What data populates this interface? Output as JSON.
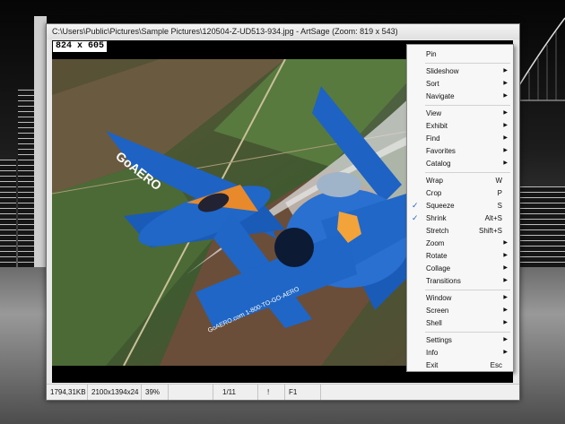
{
  "window": {
    "title": "C:\\Users\\Public\\Pictures\\Sample Pictures\\120504-Z-UD513-934.jpg - ArtSage (Zoom: 819 x 543)"
  },
  "viewer": {
    "dimensions": "824 x 605"
  },
  "statusbar": {
    "cells": [
      "1794,31KB",
      "2100x1394x24",
      "39%",
      "",
      "1/11",
      "!",
      "F1"
    ]
  },
  "menu": {
    "groups": [
      [
        {
          "label": "Pin",
          "shortcut": "",
          "submenu": false,
          "checked": false
        }
      ],
      [
        {
          "label": "Slideshow",
          "shortcut": "",
          "submenu": true,
          "checked": false
        },
        {
          "label": "Sort",
          "shortcut": "",
          "submenu": true,
          "checked": false
        },
        {
          "label": "Navigate",
          "shortcut": "",
          "submenu": true,
          "checked": false
        }
      ],
      [
        {
          "label": "View",
          "shortcut": "",
          "submenu": true,
          "checked": false
        },
        {
          "label": "Exhibit",
          "shortcut": "",
          "submenu": true,
          "checked": false
        },
        {
          "label": "Find",
          "shortcut": "",
          "submenu": true,
          "checked": false
        },
        {
          "label": "Favorites",
          "shortcut": "",
          "submenu": true,
          "checked": false
        },
        {
          "label": "Catalog",
          "shortcut": "",
          "submenu": true,
          "checked": false
        }
      ],
      [
        {
          "label": "Wrap",
          "shortcut": "W",
          "submenu": false,
          "checked": false
        },
        {
          "label": "Crop",
          "shortcut": "P",
          "submenu": false,
          "checked": false
        },
        {
          "label": "Squeeze",
          "shortcut": "S",
          "submenu": false,
          "checked": true
        },
        {
          "label": "Shrink",
          "shortcut": "Alt+S",
          "submenu": false,
          "checked": true
        },
        {
          "label": "Stretch",
          "shortcut": "Shift+S",
          "submenu": false,
          "checked": false
        },
        {
          "label": "Zoom",
          "shortcut": "",
          "submenu": true,
          "checked": false
        },
        {
          "label": "Rotate",
          "shortcut": "",
          "submenu": true,
          "checked": false
        },
        {
          "label": "Collage",
          "shortcut": "",
          "submenu": true,
          "checked": false
        },
        {
          "label": "Transitions",
          "shortcut": "",
          "submenu": true,
          "checked": false
        }
      ],
      [
        {
          "label": "Window",
          "shortcut": "",
          "submenu": true,
          "checked": false
        },
        {
          "label": "Screen",
          "shortcut": "",
          "submenu": true,
          "checked": false
        },
        {
          "label": "Shell",
          "shortcut": "",
          "submenu": true,
          "checked": false
        }
      ],
      [
        {
          "label": "Settings",
          "shortcut": "",
          "submenu": true,
          "checked": false
        },
        {
          "label": "Info",
          "shortcut": "",
          "submenu": true,
          "checked": false
        },
        {
          "label": "Exit",
          "shortcut": "Esc",
          "submenu": false,
          "checked": false
        }
      ]
    ]
  },
  "photo": {
    "plane_livery_text": "GoAERO",
    "plane_side_text": "GoAERO.com 1-800-TO-GO-AERO"
  }
}
